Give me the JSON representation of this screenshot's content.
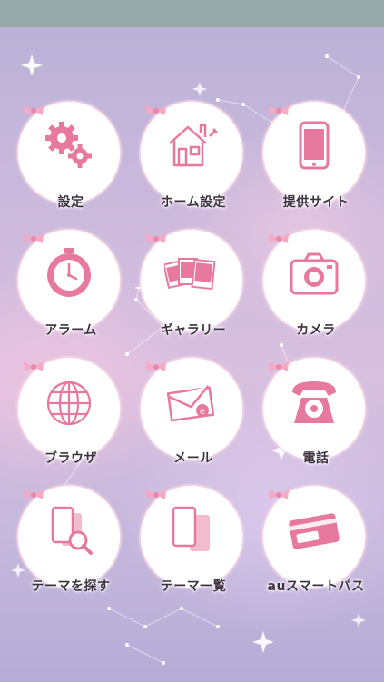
{
  "apps": [
    {
      "label": "設定",
      "icon": "gears-icon"
    },
    {
      "label": "ホーム設定",
      "icon": "house-icon"
    },
    {
      "label": "提供サイト",
      "icon": "smartphone-icon"
    },
    {
      "label": "アラーム",
      "icon": "alarm-clock-icon"
    },
    {
      "label": "ギャラリー",
      "icon": "photos-icon"
    },
    {
      "label": "カメラ",
      "icon": "camera-icon"
    },
    {
      "label": "ブラウザ",
      "icon": "globe-icon"
    },
    {
      "label": "メール",
      "icon": "envelope-icon"
    },
    {
      "label": "電話",
      "icon": "telephone-icon"
    },
    {
      "label": "テーマを探す",
      "icon": "theme-search-icon"
    },
    {
      "label": "テーマ一覧",
      "icon": "theme-list-icon"
    },
    {
      "label": "auスマートパス",
      "icon": "pass-card-icon"
    }
  ],
  "colors": {
    "accent": "#e8799e",
    "status_bar": "#97a9a8",
    "label": "#3c3240"
  }
}
